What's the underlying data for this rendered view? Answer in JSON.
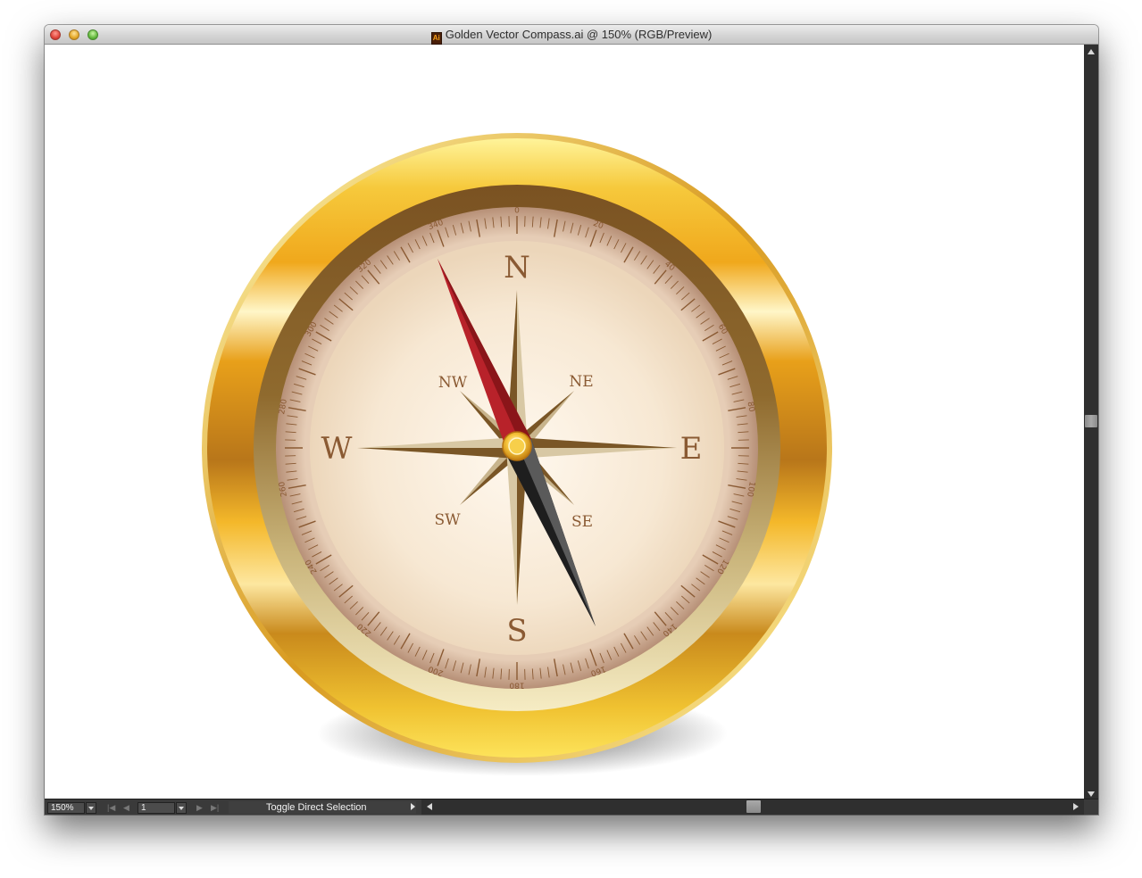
{
  "window": {
    "title": "Golden Vector Compass.ai @ 150% (RGB/Preview)",
    "file_icon": "ai-file-icon"
  },
  "compass": {
    "cardinals": {
      "n": "N",
      "e": "E",
      "s": "S",
      "w": "W"
    },
    "intercardinals": {
      "ne": "NE",
      "se": "SE",
      "sw": "SW",
      "nw": "NW"
    },
    "degree_labels": [
      "0",
      "20",
      "40",
      "60",
      "80",
      "100",
      "120",
      "140",
      "160",
      "180",
      "200",
      "220",
      "240",
      "260",
      "280",
      "300",
      "320",
      "340"
    ],
    "needle_heading": 335,
    "colors": {
      "needle_north": "#b8222a",
      "needle_south": "#1e1e1e",
      "gold": "#f2b21e",
      "dial": "#f7e8d3"
    }
  },
  "statusbar": {
    "zoom": "150%",
    "page": "1",
    "status_text": "Toggle Direct Selection"
  }
}
